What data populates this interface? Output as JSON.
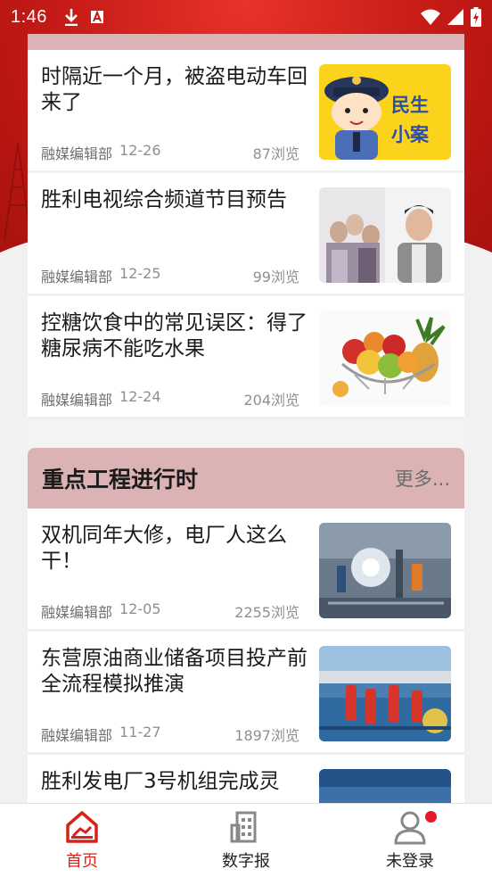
{
  "status_bar": {
    "time": "1:46"
  },
  "top_articles": [
    {
      "title": "时隔近一个月，被盗电动车回来了",
      "source": "融媒编辑部",
      "date": "12-26",
      "views": "87浏览",
      "thumb_text": [
        "民生",
        "小案"
      ]
    },
    {
      "title": "胜利电视综合频道节目预告",
      "source": "融媒编辑部",
      "date": "12-25",
      "views": "99浏览"
    },
    {
      "title": "控糖饮食中的常见误区：得了糖尿病不能吃水果",
      "source": "融媒编辑部",
      "date": "12-24",
      "views": "204浏览"
    }
  ],
  "section": {
    "title": "重点工程进行时",
    "more_label": "更多..."
  },
  "section_articles": [
    {
      "title": "双机同年大修，电厂人这么干！",
      "source": "融媒编辑部",
      "date": "12-05",
      "views": "2255浏览"
    },
    {
      "title": "东营原油商业储备项目投产前全流程模拟推演",
      "source": "融媒编辑部",
      "date": "11-27",
      "views": "1897浏览"
    },
    {
      "title": "胜利发电厂3号机组完成灵"
    }
  ],
  "bottom_nav": [
    {
      "label": "首页",
      "icon": "home-icon",
      "active": true
    },
    {
      "label": "数字报",
      "icon": "building-icon",
      "active": false
    },
    {
      "label": "未登录",
      "icon": "user-icon",
      "active": false
    }
  ],
  "colors": {
    "brand_red": "#d6221a",
    "section_pink": "#dcb3b5",
    "badge_red": "#e8192c"
  }
}
